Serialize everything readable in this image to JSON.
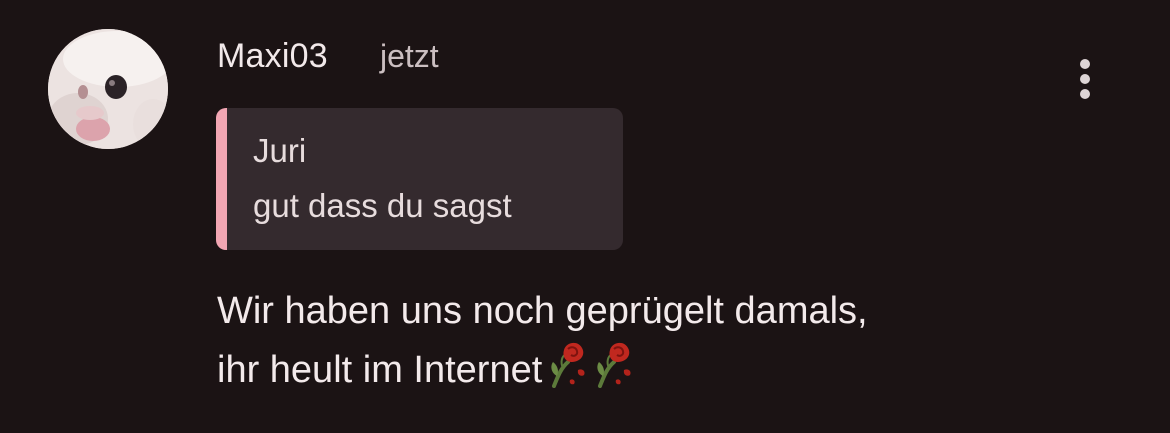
{
  "comment": {
    "username": "Maxi03",
    "time": "jetzt",
    "quote": {
      "author": "Juri",
      "text": "gut dass du sagst"
    },
    "message_line1": "Wir haben uns noch geprügelt damals,",
    "message_line2": "ihr heult im Internet",
    "emojis": [
      "wilted-rose-emoji",
      "wilted-rose-emoji"
    ]
  },
  "colors": {
    "background": "#1b1314",
    "quote_background": "#342a2e",
    "quote_accent": "#f2a6b3",
    "text_primary": "#f3eaeb",
    "text_secondary": "#cbbfc1"
  },
  "icons": {
    "more": "more-vertical-icon"
  }
}
